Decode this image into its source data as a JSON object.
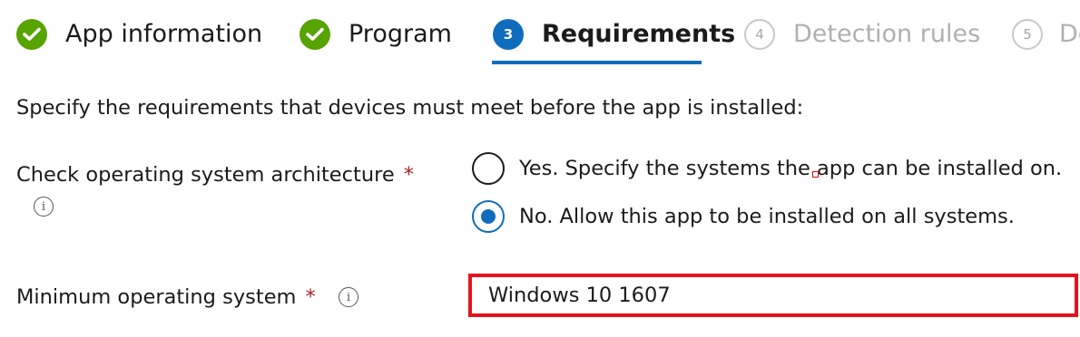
{
  "wizard": {
    "steps": [
      {
        "label": "App information",
        "state": "done",
        "icon": "checkmark-icon"
      },
      {
        "label": "Program",
        "state": "done",
        "icon": "checkmark-icon"
      },
      {
        "number": "3",
        "label": "Requirements",
        "state": "active"
      },
      {
        "number": "4",
        "label": "Detection rules",
        "state": "pending"
      },
      {
        "number": "5",
        "label": "De",
        "state": "pending"
      }
    ]
  },
  "requirements": {
    "intro": "Specify the requirements that devices must meet before the app is installed:",
    "architecture": {
      "label": "Check operating system architecture",
      "required_mark": "*",
      "info_icon": "info-icon",
      "options": [
        {
          "label": "Yes. Specify the systems the app can be installed on.",
          "selected": false
        },
        {
          "label": "No. Allow this app to be installed on all systems.",
          "selected": true
        }
      ]
    },
    "min_os": {
      "label": "Minimum operating system",
      "required_mark": "*",
      "info_icon": "info-icon",
      "value": "Windows 10 1607"
    }
  },
  "colors": {
    "success_green": "#57a300",
    "active_blue": "#0f6cbd",
    "required_red": "#a4262c",
    "highlight_red": "#e3141f"
  }
}
